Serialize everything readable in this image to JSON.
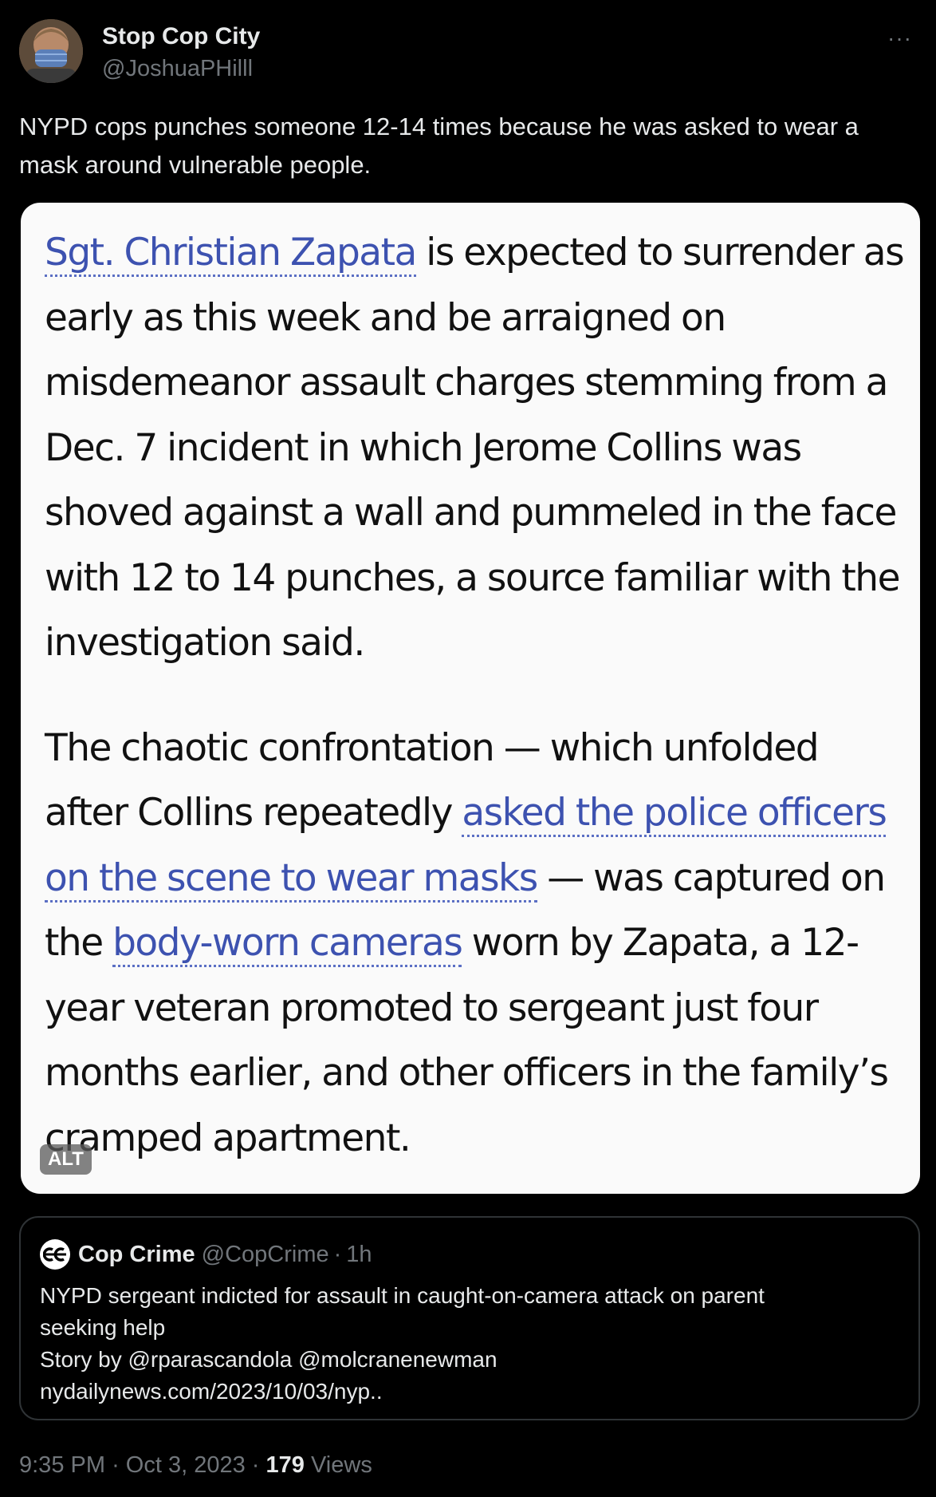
{
  "author": {
    "name": "Stop Cop City",
    "handle": "@JoshuaPHilll"
  },
  "more_label": "···",
  "tweet": {
    "text": "NYPD cops punches someone 12-14 times because he was asked to wear a mask around vulnerable people."
  },
  "media": {
    "alt_label": "ALT",
    "paragraph1": {
      "link": "Sgt. Christian Zapata",
      "text": " is expected to surrender as early as this week and be arraigned on misdemeanor assault charges stemming from a Dec. 7 incident in which Jerome Collins was shoved against a wall and pummeled in the face with 12 to 14 punches, a source familiar with the investigation said."
    },
    "paragraph2": {
      "text_a": "The chaotic confrontation — which unfolded after Collins repeatedly ",
      "link_a": "asked the police officers on the scene to wear masks",
      "text_b": " — was captured on the ",
      "link_b": "body-worn cameras",
      "text_c": " worn by  Zapata, a 12-year veteran promoted to sergeant just four months earlier, and other officers in the family’s cramped apartment."
    }
  },
  "quote": {
    "logo_text": "CC",
    "name": "Cop Crime",
    "handle": "@CopCrime",
    "separator": "·",
    "time": "1h",
    "lines": [
      "NYPD sergeant indicted for assault in caught-on-camera attack on parent",
      "seeking help",
      "Story by @rparascandola @molcranenewman",
      "nydailynews.com/2023/10/03/nyp.."
    ]
  },
  "meta": {
    "time": "9:35 PM",
    "sep1": "·",
    "date": "Oct 3, 2023",
    "sep2": "·",
    "views_count": "179",
    "views_label": "Views"
  }
}
